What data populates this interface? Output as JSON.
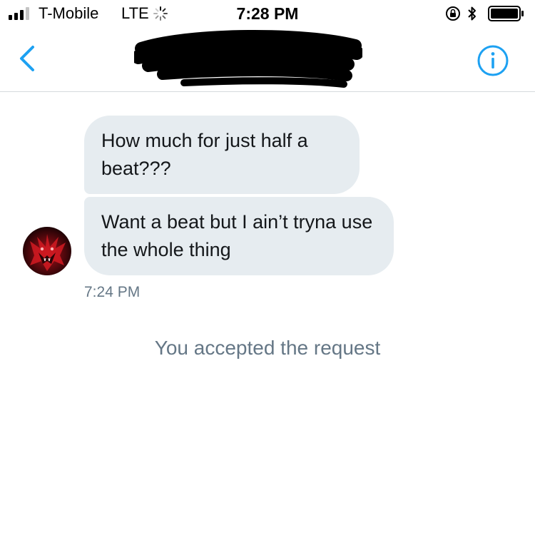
{
  "status_bar": {
    "carrier": "T-Mobile",
    "network": "LTE",
    "time": "7:28 PM",
    "signal_bars_active": 3,
    "signal_bars_total": 4,
    "icons": [
      "signal-icon",
      "loading-spinner-icon",
      "rotation-lock-icon",
      "bluetooth-icon",
      "battery-icon"
    ]
  },
  "nav_bar": {
    "back_icon": "chevron-left-icon",
    "title_redacted": true,
    "info_icon": "info-icon",
    "accent_color": "#1da1f2"
  },
  "conversation": {
    "messages": [
      {
        "text": "How much for just half a beat???"
      },
      {
        "text": "Want a beat but I ain’t tryna use the whole thing"
      }
    ],
    "timestamp": "7:24 PM",
    "system_note": "You accepted the request"
  },
  "colors": {
    "bubble_received": "#e6ecf0",
    "secondary_text": "#657786",
    "accent": "#1da1f2"
  }
}
